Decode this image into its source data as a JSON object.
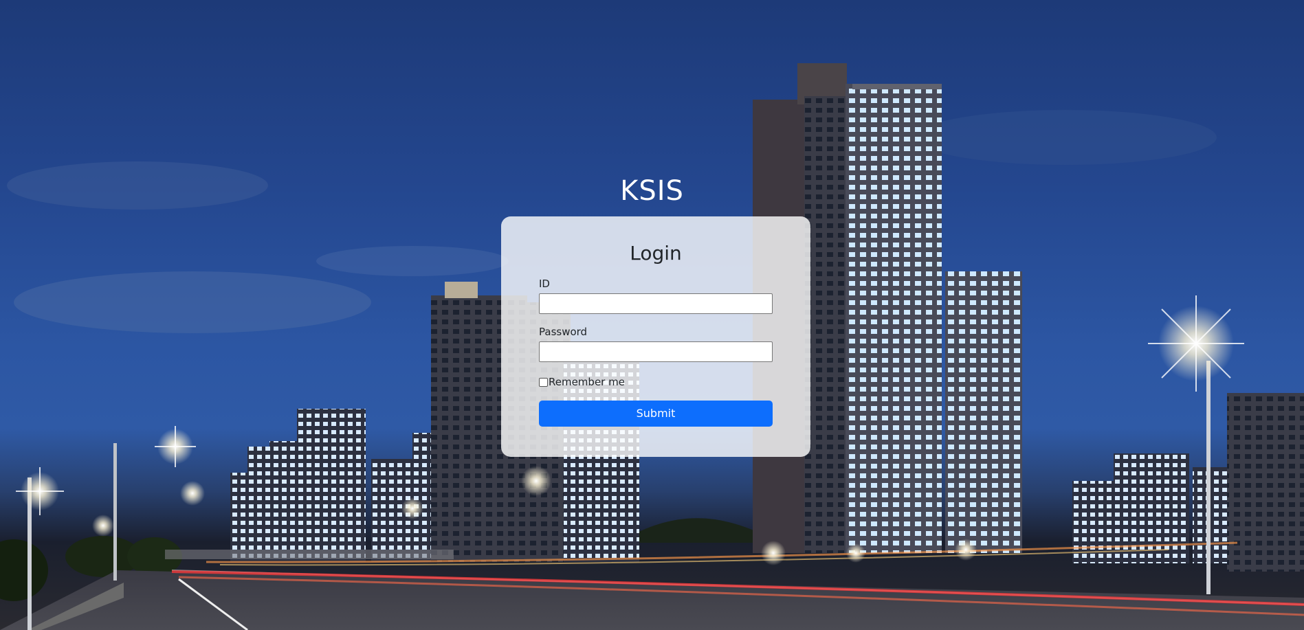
{
  "header": {
    "site_title": "KSIS"
  },
  "login_form": {
    "heading": "Login",
    "id_label": "ID",
    "id_value": "",
    "password_label": "Password",
    "password_value": "",
    "remember_label": "Remember me",
    "remember_checked": false,
    "submit_label": "Submit"
  },
  "colors": {
    "primary_button": "#0d6efd",
    "card_background": "rgba(255,255,255,0.80)"
  }
}
